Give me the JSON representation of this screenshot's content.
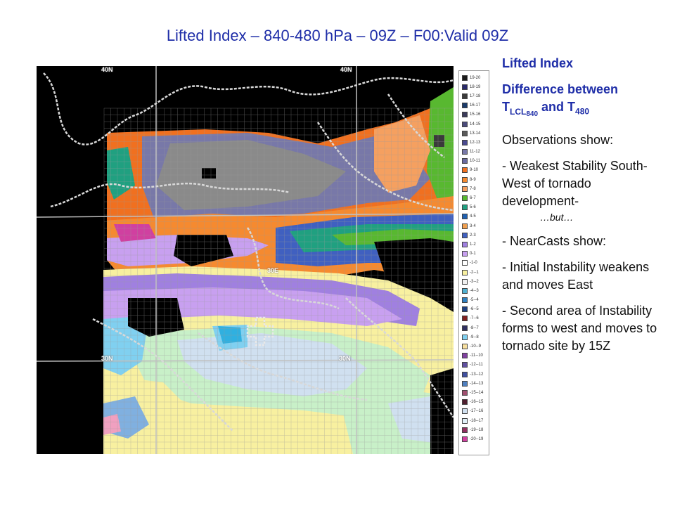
{
  "title": "Lifted Index – 840-480 hPa – 09Z – F00:Valid 09Z",
  "map": {
    "labels": [
      "40N",
      "40N",
      "30E",
      "30N",
      "30N"
    ],
    "colors": {
      "background": "#000000",
      "grid": "#a0a0a0",
      "borders": "#d8d8d8"
    }
  },
  "legend": {
    "items": [
      {
        "label": "19-20",
        "color": "#1a1a1a"
      },
      {
        "label": "18-19",
        "color": "#2a2a6a"
      },
      {
        "label": "17-18",
        "color": "#3a3a3a"
      },
      {
        "label": "16-17",
        "color": "#1a3a6a"
      },
      {
        "label": "15-16",
        "color": "#3a3a5a"
      },
      {
        "label": "14-15",
        "color": "#4a4a7a"
      },
      {
        "label": "13-14",
        "color": "#5a5a5a"
      },
      {
        "label": "12-13",
        "color": "#4a4a90"
      },
      {
        "label": "11-12",
        "color": "#7878a8"
      },
      {
        "label": "10-11",
        "color": "#6a6aa0"
      },
      {
        "label": "9-10",
        "color": "#f07020"
      },
      {
        "label": "8-9",
        "color": "#f58a30"
      },
      {
        "label": "7-8",
        "color": "#f5a060"
      },
      {
        "label": "6-7",
        "color": "#58b830"
      },
      {
        "label": "5-6",
        "color": "#20a080"
      },
      {
        "label": "4-5",
        "color": "#2060b0"
      },
      {
        "label": "3-4",
        "color": "#f0a050"
      },
      {
        "label": "2-3",
        "color": "#4060c0"
      },
      {
        "label": "1-2",
        "color": "#a080e0"
      },
      {
        "label": "0-1",
        "color": "#c8a0f0"
      },
      {
        "label": "-1-0",
        "color": "#ffffff"
      },
      {
        "label": "-2--1",
        "color": "#f8f0a0"
      },
      {
        "label": "-3--2",
        "color": "#f0f0f0"
      },
      {
        "label": "-4--3",
        "color": "#50b0d0"
      },
      {
        "label": "-5--4",
        "color": "#3080c0"
      },
      {
        "label": "-6--5",
        "color": "#204080"
      },
      {
        "label": "-7--6",
        "color": "#802020"
      },
      {
        "label": "-8--7",
        "color": "#303060"
      },
      {
        "label": "-9--8",
        "color": "#80d0f0"
      },
      {
        "label": "-10--9",
        "color": "#f8e0a0"
      },
      {
        "label": "-11--10",
        "color": "#8040a0"
      },
      {
        "label": "-12--11",
        "color": "#6050a0"
      },
      {
        "label": "-13--12",
        "color": "#4050a0"
      },
      {
        "label": "-14--13",
        "color": "#5080c0"
      },
      {
        "label": "-15--14",
        "color": "#a05070"
      },
      {
        "label": "-16--15",
        "color": "#502030"
      },
      {
        "label": "-17--16",
        "color": "#d0e0f0"
      },
      {
        "label": "-18--17",
        "color": "#e0f0f8"
      },
      {
        "label": "-19--18",
        "color": "#903060"
      },
      {
        "label": "-20--19",
        "color": "#d040a0"
      }
    ]
  },
  "side": {
    "heading": "Lifted Index",
    "diff_line": "Difference between",
    "t": "T",
    "lcl": "LCL",
    "lcl_level": "840",
    "and": " and  T",
    "upper_level": "480",
    "obs": "Observations show:",
    "bullet1": "- Weakest Stability South-West of tornado development-",
    "but": "…but…",
    "bullet2": "- NearCasts show:",
    "bullet3": "- Initial Instability weakens and moves East",
    "bullet4": "- Second area of Instability forms to west and moves to tornado site by 15Z"
  }
}
